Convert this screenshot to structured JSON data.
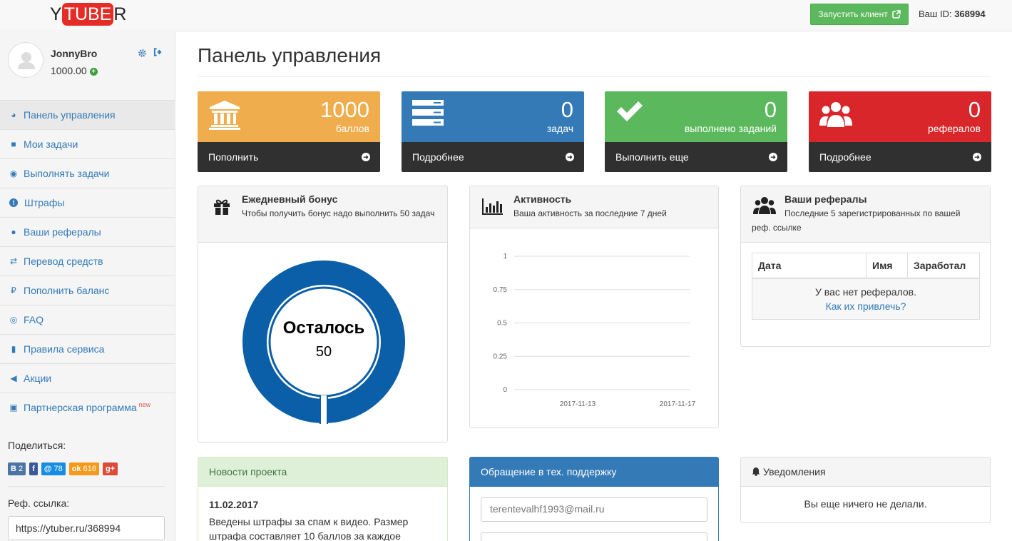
{
  "header": {
    "logo_y": "Y",
    "logo_tube": "TUBE",
    "logo_r": "R",
    "run_client": "Запустить клиент",
    "id_label": "Ваш ID:",
    "id_value": "368994"
  },
  "user": {
    "name": "JonnyBro",
    "balance": "1000.00"
  },
  "menu": [
    {
      "label": "Панель управления",
      "icon": "tachometer-icon",
      "active": true
    },
    {
      "label": "Мои задачи",
      "icon": "video-camera-icon"
    },
    {
      "label": "Выполнять задачи",
      "icon": "eye-icon"
    },
    {
      "label": "Штрафы",
      "icon": "exclamation-icon"
    },
    {
      "label": "Ваши рефералы",
      "icon": "users-icon"
    },
    {
      "label": "Перевод средств",
      "icon": "exchange-icon"
    },
    {
      "label": "Пополнить баланс",
      "icon": "ruble-icon"
    },
    {
      "label": "FAQ",
      "icon": "lifebuoy-icon"
    },
    {
      "label": "Правила сервиса",
      "icon": "book-icon"
    },
    {
      "label": "Акции",
      "icon": "bullhorn-icon"
    },
    {
      "label": "Партнерская программа",
      "icon": "money-icon",
      "badge": "new"
    }
  ],
  "share": {
    "label": "Поделиться:",
    "buttons": [
      {
        "icon": "vk-icon",
        "glyph": "B",
        "count": "2",
        "color": "#4c75a3"
      },
      {
        "icon": "facebook-icon",
        "glyph": "f",
        "count": "",
        "color": "#3b5998"
      },
      {
        "icon": "mailru-icon",
        "glyph": "@",
        "count": "78",
        "color": "#168de2"
      },
      {
        "icon": "odnoklassniki-icon",
        "glyph": "ok",
        "count": "616",
        "color": "#f59a1a"
      },
      {
        "icon": "googleplus-icon",
        "glyph": "g+",
        "count": "",
        "color": "#dd4b39"
      }
    ]
  },
  "ref": {
    "label": "Реф. ссылка:",
    "value": "https://ytuber.ru/368994"
  },
  "page_title": "Панель управления",
  "stats": [
    {
      "value": "1000",
      "label": "баллов",
      "action": "Пополнить",
      "color": "#f0ad4e",
      "icon": "bank-icon"
    },
    {
      "value": "0",
      "label": "задач",
      "action": "Подробнее",
      "color": "#337ab7",
      "icon": "tasks-list-icon"
    },
    {
      "value": "0",
      "label": "выполнено заданий",
      "action": "Выполнить еще",
      "color": "#5cb85c",
      "icon": "check-icon"
    },
    {
      "value": "0",
      "label": "рефералов",
      "action": "Подробнее",
      "color": "#d9262a",
      "icon": "users-icon"
    }
  ],
  "bonus": {
    "title": "Ежедневный бонус",
    "subtitle": "Чтобы получить бонус надо выполнить 50 задач",
    "remain_label": "Осталось",
    "remain_value": "50",
    "progress": 0.0,
    "ring_color": "#0b5ea8"
  },
  "activity": {
    "title": "Активность",
    "subtitle": "Ваша активность за последние 7 дней"
  },
  "chart_data": {
    "type": "line",
    "x": [
      "2017-11-13",
      "2017-11-17"
    ],
    "xticks": [
      "2017-11-13",
      "2017-11-17"
    ],
    "yticks": [
      "1",
      "0.75",
      "0.5",
      "0.25",
      "0"
    ],
    "ylim": [
      0,
      1
    ],
    "series": [],
    "grid": true
  },
  "referrals": {
    "title": "Ваши рефералы",
    "subtitle": "Последние 5 зарегистрированных по вашей реф. ссылке",
    "columns": [
      "Дата",
      "Имя",
      "Заработал"
    ],
    "empty_text": "У вас нет рефералов.",
    "empty_link": "Как их привлечь?"
  },
  "news": {
    "title": "Новости проекта",
    "date": "11.02.2017",
    "text": "Введены штрафы за спам к видео. Размер штрафа составляет 10 баллов за каждое"
  },
  "support": {
    "title": "Обращение в тех. поддержку",
    "email_value": "terentevalhf1993@mail.ru"
  },
  "notifications": {
    "title": "Уведомления",
    "empty_text": "Вы еще ничего не делали."
  }
}
